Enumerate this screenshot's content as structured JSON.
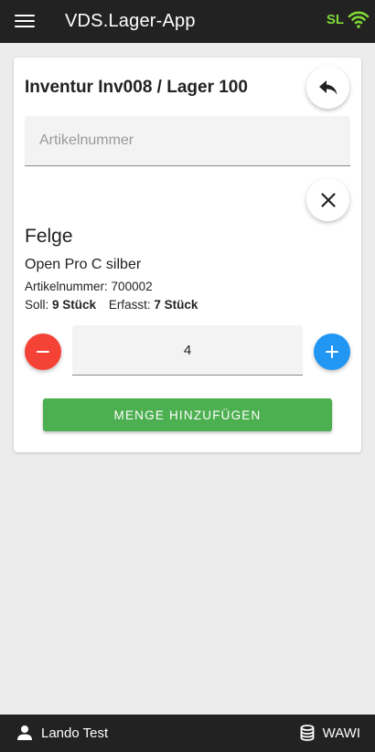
{
  "appbar": {
    "title": "VDS.Lager-App",
    "status_code": "SL",
    "status_color": "#7fd836",
    "menu_icon": "hamburger-menu-icon",
    "connection_icon": "wifi-icon"
  },
  "card": {
    "title": "Inventur Inv008 / Lager 100",
    "back_icon": "reply-arrow-icon",
    "close_icon": "close-icon",
    "search": {
      "placeholder": "Artikelnummer",
      "value": ""
    },
    "item": {
      "name": "Felge",
      "description": "Open Pro C silber",
      "number_label": "Artikelnummer:",
      "number_value": "700002",
      "soll_label": "Soll:",
      "soll_value": "9 Stück",
      "erfasst_label": "Erfasst:",
      "erfasst_value": "7 Stück"
    },
    "quantity": {
      "value": "4",
      "minus_icon": "minus-icon",
      "plus_icon": "plus-icon",
      "minus_color": "#f44336",
      "plus_color": "#2196f3"
    },
    "add_button": {
      "label": "MENGE HINZUFÜGEN",
      "color": "#4caf50"
    }
  },
  "bottombar": {
    "user_icon": "person-icon",
    "user_name": "Lando Test",
    "db_icon": "database-icon",
    "db_name": "WAWI"
  }
}
